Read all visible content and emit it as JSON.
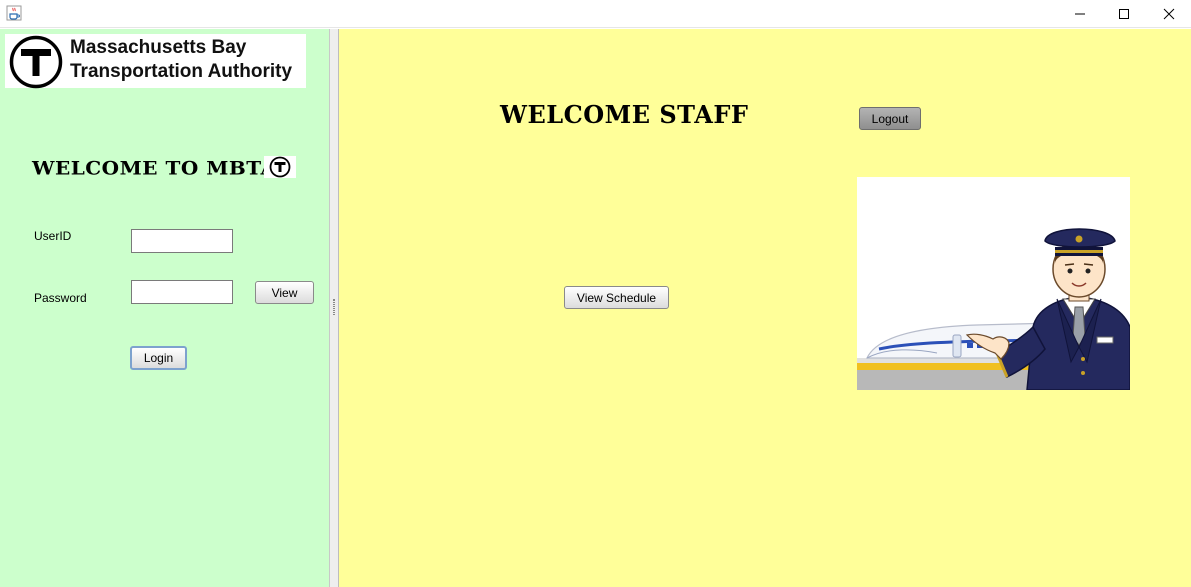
{
  "window": {
    "app_icon": "java-cup-icon",
    "controls": [
      "minimize-icon",
      "maximize-icon",
      "close-icon"
    ]
  },
  "left_pane": {
    "logo": {
      "line1": "Massachusetts Bay",
      "line2": "Transportation Authority",
      "icon": "mbta-t-logo-icon"
    },
    "welcome": "WELCOME TO MBTA",
    "userid_label": "UserID",
    "userid_value": "",
    "password_label": "Password",
    "password_value": "",
    "view_button": "View",
    "login_button": "Login",
    "background": "#ccffcc"
  },
  "right_pane": {
    "welcome": "WELCOME STAFF",
    "logout_button": "Logout",
    "view_schedule_button": "View Schedule",
    "illustration": "train-conductor-illustration",
    "background": "#ffff99"
  }
}
